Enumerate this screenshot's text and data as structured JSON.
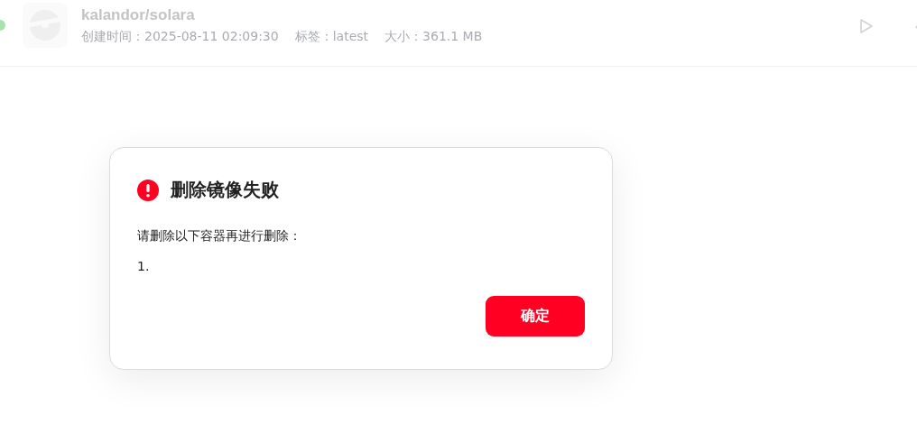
{
  "image_row": {
    "color": "#a8e3ae",
    "name": "kalandor/solara",
    "meta": [
      "创建时间：2025-08-11 02:09:30",
      "标签：latest",
      "大小：361.1 MB"
    ]
  },
  "dialog": {
    "kind": "error",
    "title": "删除镜像失败",
    "message": "请删除以下容器再进行删除：",
    "items": [
      "1."
    ],
    "buttons": [
      {
        "label": "确定",
        "kind": "primary"
      }
    ]
  }
}
